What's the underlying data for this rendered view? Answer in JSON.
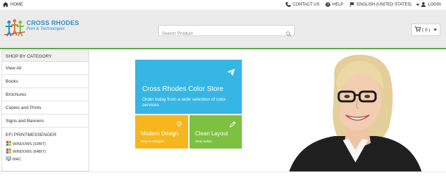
{
  "topbar": {
    "home_label": "HOME",
    "contact_label": "CONTACT US",
    "help_label": "HELP",
    "language_label": "ENGLISH (UNITED STATES)",
    "login_label": "LOGIN"
  },
  "logo": {
    "title": "CROSS RHODES",
    "subtitle": "Print & Technologies"
  },
  "search": {
    "placeholder": "Search Product"
  },
  "cart": {
    "count_label": "( 0 )"
  },
  "sidebar": {
    "heading": "SHOP BY CATEGORY",
    "items": [
      {
        "label": "View All"
      },
      {
        "label": "Books"
      },
      {
        "label": "Brochures"
      },
      {
        "label": "Copies and Prints"
      },
      {
        "label": "Signs and Banners"
      }
    ],
    "subheading": "EFI PRINTMESSENGER",
    "os_items": [
      {
        "label": "WINDOWS (32BIT)"
      },
      {
        "label": "WINDOWS (64BIT)"
      },
      {
        "label": "MAC"
      }
    ]
  },
  "tiles": {
    "main_title": "Cross Rhodes Color Store",
    "main_text": "Order today from a wide selection of color services.",
    "modern_title": "Modern Design",
    "modern_sub": "Easy to navigate",
    "clean_title": "Clean Layout",
    "clean_sub": "Shop today!"
  },
  "colors": {
    "tile_blue": "#36b6e4",
    "tile_yellow": "#f5b71d",
    "tile_green": "#7dc142",
    "accent_line": "#5aa846",
    "logo_blue": "#2a8fc7"
  }
}
